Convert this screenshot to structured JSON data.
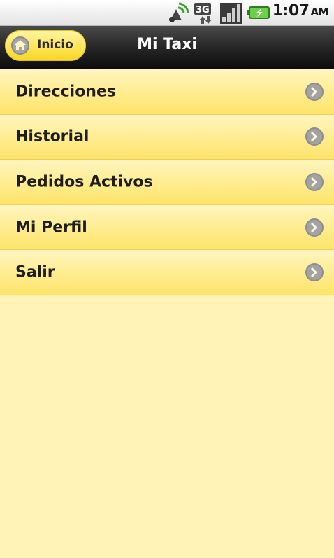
{
  "status_bar": {
    "time": "1:07",
    "ampm": "AM",
    "icons": [
      "gps-icon",
      "3g-data-icon",
      "signal-strength-icon",
      "battery-charging-icon"
    ],
    "accent_green": "#3aa52b"
  },
  "title_bar": {
    "home_label": "Inicio",
    "title": "Mi Taxi"
  },
  "menu": {
    "items": [
      {
        "label": "Direcciones"
      },
      {
        "label": "Historial"
      },
      {
        "label": "Pedidos Activos"
      },
      {
        "label": "Mi Perfil"
      },
      {
        "label": "Salir"
      }
    ]
  },
  "colors": {
    "menu_yellow": "#ffe36b",
    "background": "#fff3b8",
    "title_bar": "#1a1a1a"
  }
}
